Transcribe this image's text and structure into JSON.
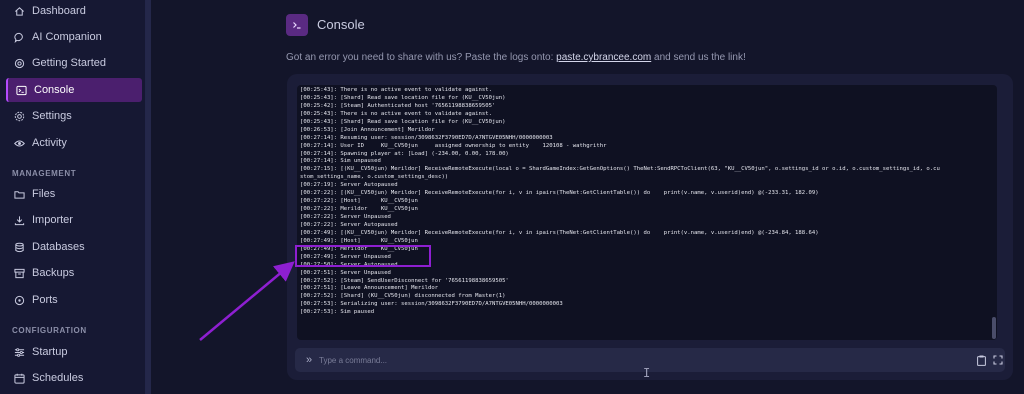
{
  "sidebar": {
    "items": [
      {
        "label": "Dashboard",
        "icon": "house-icon"
      },
      {
        "label": "AI Companion",
        "icon": "chat-bubble-icon"
      },
      {
        "label": "Getting Started",
        "icon": "lifebuoy-icon"
      },
      {
        "label": "Console",
        "icon": "terminal-icon",
        "active": true
      },
      {
        "label": "Settings",
        "icon": "gear-icon"
      },
      {
        "label": "Activity",
        "icon": "eye-icon"
      }
    ],
    "management_title": "MANAGEMENT",
    "management_items": [
      {
        "label": "Files",
        "icon": "folder-icon"
      },
      {
        "label": "Importer",
        "icon": "download-icon"
      },
      {
        "label": "Databases",
        "icon": "database-icon"
      },
      {
        "label": "Backups",
        "icon": "archive-icon"
      },
      {
        "label": "Ports",
        "icon": "network-icon"
      }
    ],
    "configuration_title": "CONFIGURATION",
    "configuration_items": [
      {
        "label": "Startup",
        "icon": "sliders-icon"
      },
      {
        "label": "Schedules",
        "icon": "calendar-icon"
      }
    ]
  },
  "header": {
    "title": "Console"
  },
  "subtitle": {
    "before": "Got an error you need to share with us? Paste the logs onto: ",
    "link": "paste.cybrancee.com",
    "after": " and send us the link!"
  },
  "console": {
    "lines": [
      "[00:25:43]: There is no active event to validate against.",
      "[00:25:43]: [Shard] Read save location file for (KU__CV50jun)",
      "[00:25:42]: [Steam] Authenticated host '76561198838659505'",
      "[00:25:43]: There is no active event to validate against.",
      "[00:25:43]: [Shard] Read save location file for (KU__CV50jun)",
      "[00:26:53]: [Join Announcement] Merildor",
      "[00:27:14]: Resuming user: session/3098632F3790ED7D/A7NTGVE05NHH/0000000003",
      "[00:27:14]: User ID     KU__CV50jun     assigned ownership to entity    120108 - wathgrithr",
      "[00:27:14]: Spawning player at: [Load] (-234.00, 0.00, 178.00)",
      "[00:27:14]: Sim unpaused",
      "[00:27:15]: [(KU__CV50jun) Merildor] ReceiveRemoteExecute(local o = ShardGameIndex:GetGenOptions() TheNet:SendRPCToClient(63, \"KU__CV50jun\", o.settings_id or o.id, o.custom_settings_id, o.cu",
      "stom_settings_name, o.custom_settings_desc))",
      "[00:27:19]: Server Autopaused",
      "[00:27:22]: [(KU__CV50jun) Merildor] ReceiveRemoteExecute(for i, v in ipairs(TheNet:GetClientTable()) do    print(v.name, v.userid)end) @(-233.31, 182.09)",
      "[00:27:22]: [Host]      KU__CV50jun",
      "[00:27:22]: Merildor    KU__CV50jun",
      "[00:27:22]: Server Unpaused",
      "[00:27:22]: Server Autopaused",
      "[00:27:49]: [(KU__CV50jun) Merildor] ReceiveRemoteExecute(for i, v in ipairs(TheNet:GetClientTable()) do    print(v.name, v.userid)end) @(-234.84, 188.64)",
      "[00:27:49]: [Host]      KU__CV50jun",
      "[00:27:49]: Merildor    KU__CV50jun",
      "[00:27:49]: Server Unpaused",
      "[00:27:50]: Server Autopaused",
      "[00:27:51]: Server Unpaused",
      "[00:27:52]: [Steam] SendUserDisconnect for '76561198838659505'",
      "[00:27:51]: [Leave Announcement] Merildor",
      "[00:27:52]: [Shard] (KU__CV50jun) disconnected from Master(1)",
      "[00:27:53]: Serializing user: session/3098632F3790ED7D/A7NTGVE05NHH/0000000003",
      "[00:27:53]: Sim paused"
    ],
    "input_placeholder": "Type a command..."
  },
  "colors": {
    "accent": "#8e1fd1",
    "active_bg": "#4b1f6e",
    "background": "#13152a"
  }
}
